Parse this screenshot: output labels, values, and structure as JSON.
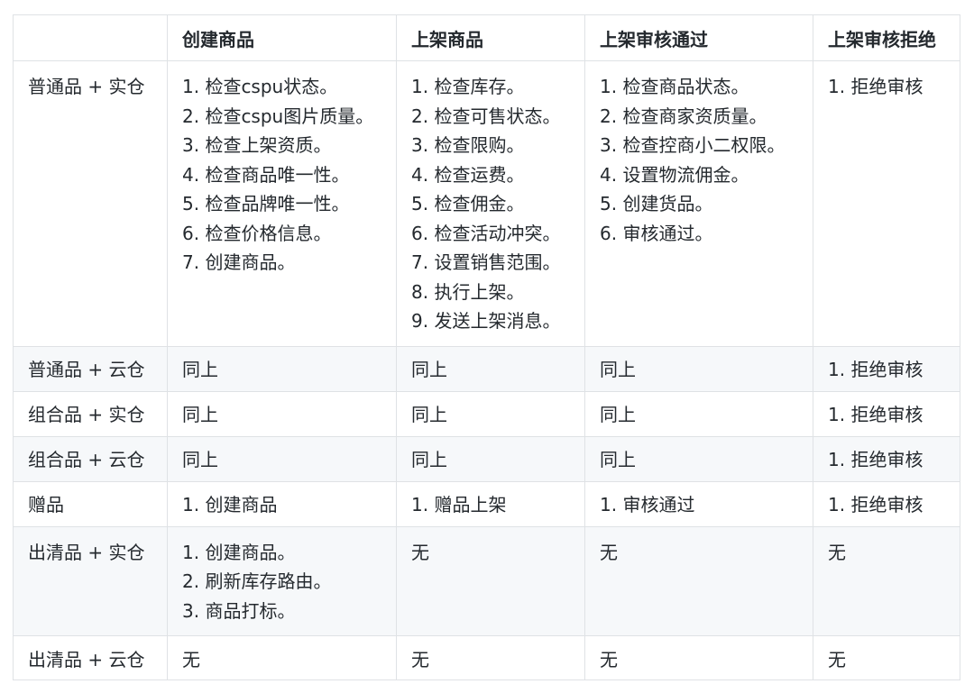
{
  "table": {
    "headers": [
      "",
      "创建商品",
      "上架商品",
      "上架审核通过",
      "上架审核拒绝"
    ],
    "rows": [
      {
        "label": "普通品 + 实仓",
        "cells": [
          [
            "1. 检查cspu状态。",
            "2. 检查cspu图片质量。",
            "3. 检查上架资质。",
            "4. 检查商品唯一性。",
            "5. 检查品牌唯一性。",
            "6. 检查价格信息。",
            "7. 创建商品。"
          ],
          [
            "1. 检查库存。",
            "2. 检查可售状态。",
            "3. 检查限购。",
            "4. 检查运费。",
            "5. 检查佣金。",
            "6. 检查活动冲突。",
            "7. 设置销售范围。",
            "8. 执行上架。",
            "9. 发送上架消息。"
          ],
          [
            "1. 检查商品状态。",
            "2. 检查商家资质量。",
            "3. 检查控商小二权限。",
            "4. 设置物流佣金。",
            "5. 创建货品。",
            "6. 审核通过。"
          ],
          [
            "1. 拒绝审核"
          ]
        ]
      },
      {
        "label": "普通品 + 云仓",
        "cells": [
          [
            "同上"
          ],
          [
            "同上"
          ],
          [
            "同上"
          ],
          [
            "1. 拒绝审核"
          ]
        ]
      },
      {
        "label": "组合品 + 实仓",
        "cells": [
          [
            "同上"
          ],
          [
            "同上"
          ],
          [
            "同上"
          ],
          [
            "1. 拒绝审核"
          ]
        ]
      },
      {
        "label": "组合品 + 云仓",
        "cells": [
          [
            "同上"
          ],
          [
            "同上"
          ],
          [
            "同上"
          ],
          [
            "1. 拒绝审核"
          ]
        ]
      },
      {
        "label": "赠品",
        "cells": [
          [
            "1. 创建商品"
          ],
          [
            "1. 赠品上架"
          ],
          [
            "1. 审核通过"
          ],
          [
            "1. 拒绝审核"
          ]
        ]
      },
      {
        "label": "出清品 + 实仓",
        "cells": [
          [
            "1. 创建商品。",
            "2. 刷新库存路由。",
            "3. 商品打标。"
          ],
          [
            "无"
          ],
          [
            "无"
          ],
          [
            "无"
          ]
        ]
      },
      {
        "label": "出清品 + 云仓",
        "cells": [
          [
            "无"
          ],
          [
            "无"
          ],
          [
            "无"
          ],
          [
            "无"
          ]
        ]
      }
    ]
  }
}
